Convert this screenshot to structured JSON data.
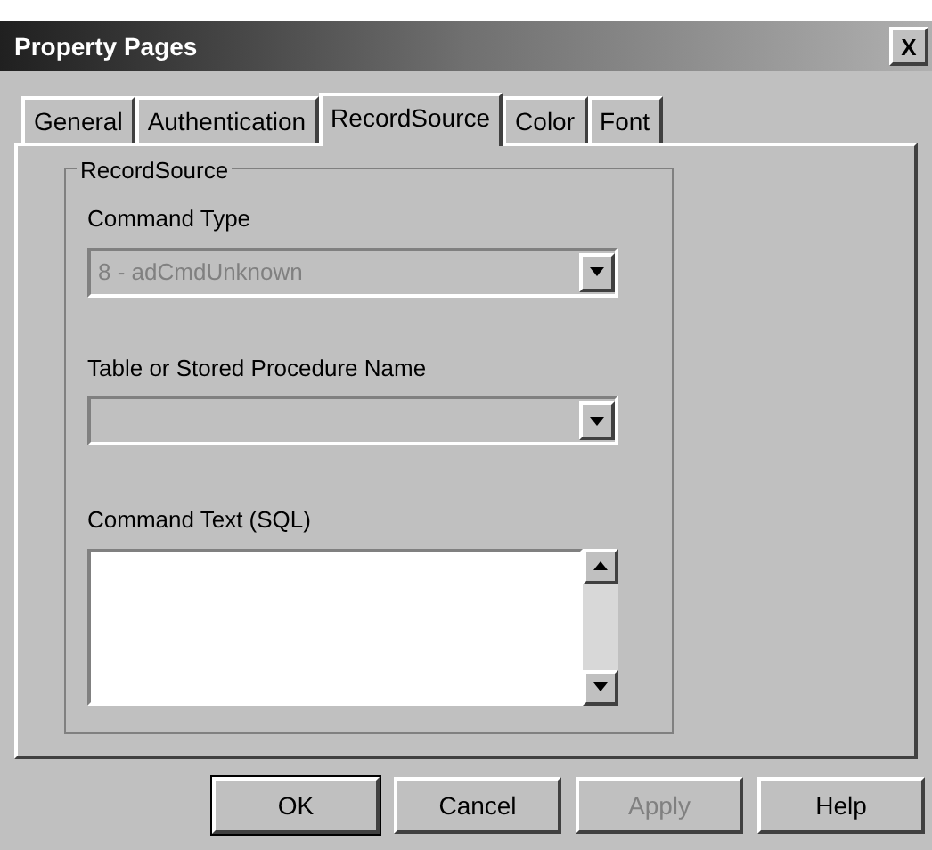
{
  "window": {
    "title": "Property Pages",
    "close": "X"
  },
  "tabs": [
    {
      "label": "General",
      "selected": false
    },
    {
      "label": "Authentication",
      "selected": false
    },
    {
      "label": "RecordSource",
      "selected": true
    },
    {
      "label": "Color",
      "selected": false
    },
    {
      "label": "Font",
      "selected": false
    }
  ],
  "group": {
    "title": "RecordSource",
    "command_type": {
      "label": "Command Type",
      "value": "8 - adCmdUnknown",
      "disabled": true
    },
    "table_name": {
      "label": "Table or Stored Procedure Name",
      "disabled": true
    },
    "command_text": {
      "label": "Command Text (SQL)"
    }
  },
  "buttons": [
    {
      "label": "OK",
      "disabled": false
    },
    {
      "label": "Cancel",
      "disabled": false
    },
    {
      "label": "Apply",
      "disabled": true
    },
    {
      "label": "Help",
      "disabled": false
    }
  ]
}
